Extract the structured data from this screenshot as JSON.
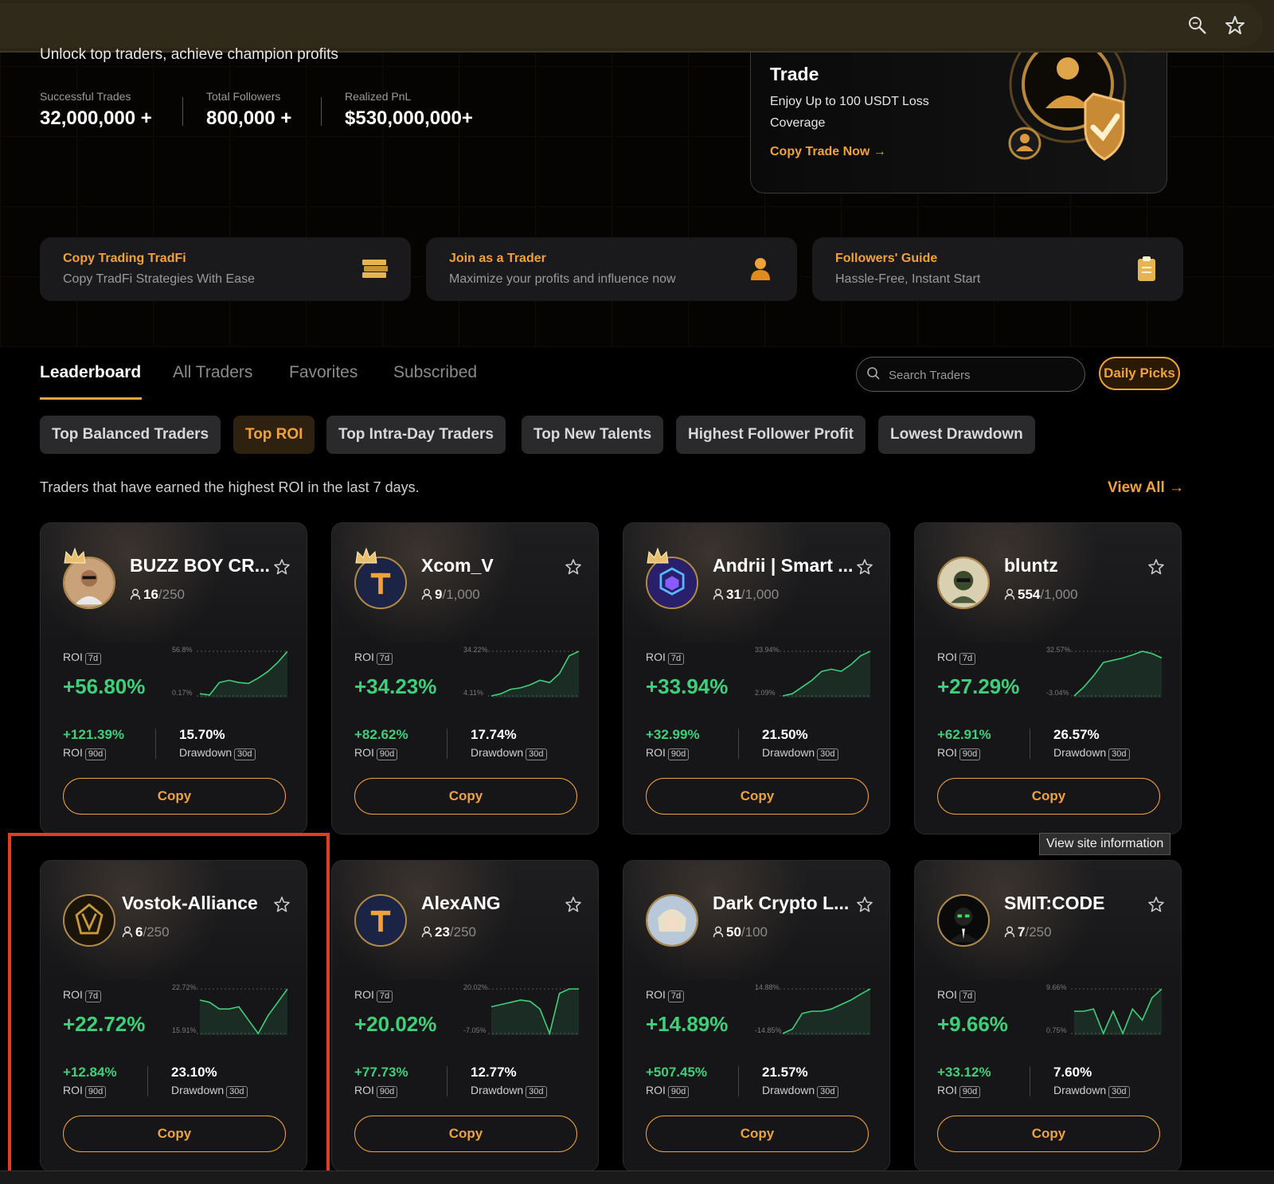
{
  "hero": {
    "subtitle": "Unlock top traders, achieve champion profits",
    "stats": [
      {
        "label": "Successful Trades",
        "value": "32,000,000 +"
      },
      {
        "label": "Total Followers",
        "value": "800,000 +"
      },
      {
        "label": "Realized PnL",
        "value": "$530,000,000+"
      }
    ],
    "promo": {
      "title": "Trade",
      "text": "Enjoy Up to 100 USDT Loss Coverage",
      "cta": "Copy Trade Now →"
    }
  },
  "quick_links": [
    {
      "title": "Copy Trading TradFi",
      "subtitle": "Copy TradFi Strategies With Ease",
      "icon": "gold-bars-icon"
    },
    {
      "title": "Join as a Trader",
      "subtitle": "Maximize your profits and influence now",
      "icon": "trader-person-icon"
    },
    {
      "title": "Followers' Guide",
      "subtitle": "Hassle-Free, Instant Start",
      "icon": "clipboard-icon"
    }
  ],
  "tabs": [
    "Leaderboard",
    "All Traders",
    "Favorites",
    "Subscribed"
  ],
  "search": {
    "placeholder": "Search Traders"
  },
  "daily_picks": "Daily Picks",
  "filters": [
    "Top Balanced Traders",
    "Top ROI",
    "Top Intra-Day Traders",
    "Top New Talents",
    "Highest Follower Profit",
    "Lowest Drawdown"
  ],
  "description": "Traders that have earned the highest ROI in the last 7 days.",
  "view_all": "View All →",
  "labels": {
    "roi": "ROI",
    "drawdown": "Drawdown",
    "d7": "7d",
    "d90": "90d",
    "d30": "30d",
    "copy": "Copy"
  },
  "tooltip": "View site information",
  "traders": [
    {
      "name": "BUZZ BOY CR...",
      "followers": "16",
      "cap": "/250",
      "roi7": "+56.80%",
      "spark_max": "56.8%",
      "spark_min": "0.17%",
      "roi90": "+121.39%",
      "drawdown": "15.70%",
      "crown": true,
      "spark": [
        0.05,
        0.02,
        0.3,
        0.35,
        0.3,
        0.28,
        0.4,
        0.55,
        0.75,
        1.0
      ]
    },
    {
      "name": "Xcom_V",
      "followers": "9",
      "cap": "/1,000",
      "roi7": "+34.23%",
      "spark_max": "34.22%",
      "spark_min": "4.11%",
      "roi90": "+82.62%",
      "drawdown": "17.74%",
      "crown": true,
      "spark": [
        0.0,
        0.05,
        0.15,
        0.18,
        0.25,
        0.35,
        0.3,
        0.5,
        0.9,
        1.0
      ]
    },
    {
      "name": "Andrii | Smart ...",
      "followers": "31",
      "cap": "/1,000",
      "roi7": "+33.94%",
      "spark_max": "33.94%",
      "spark_min": "2.09%",
      "roi90": "+32.99%",
      "drawdown": "21.50%",
      "crown": true,
      "spark": [
        0.0,
        0.05,
        0.2,
        0.35,
        0.55,
        0.6,
        0.55,
        0.7,
        0.9,
        1.0
      ]
    },
    {
      "name": "bluntz",
      "followers": "554",
      "cap": "/1,000",
      "roi7": "+27.29%",
      "spark_max": "32.57%",
      "spark_min": "-3.04%",
      "roi90": "+62.91%",
      "drawdown": "26.57%",
      "crown": false,
      "spark": [
        0.0,
        0.2,
        0.45,
        0.75,
        0.8,
        0.85,
        0.92,
        1.0,
        0.95,
        0.85
      ]
    },
    {
      "name": "Vostok-Alliance",
      "followers": "6",
      "cap": "/250",
      "roi7": "+22.72%",
      "spark_max": "22.72%",
      "spark_min": "15.91%",
      "roi90": "+12.84%",
      "drawdown": "23.10%",
      "crown": false,
      "spark": [
        0.75,
        0.7,
        0.55,
        0.55,
        0.6,
        0.3,
        0.0,
        0.4,
        0.7,
        1.0
      ]
    },
    {
      "name": "AlexANG",
      "followers": "23",
      "cap": "/250",
      "roi7": "+20.02%",
      "spark_max": "20.02%",
      "spark_min": "-7.05%",
      "roi90": "+77.73%",
      "drawdown": "12.77%",
      "crown": false,
      "spark": [
        0.6,
        0.65,
        0.7,
        0.75,
        0.72,
        0.55,
        0.0,
        0.9,
        1.0,
        1.0
      ]
    },
    {
      "name": "Dark Crypto L...",
      "followers": "50",
      "cap": "/100",
      "roi7": "+14.89%",
      "spark_max": "14.88%",
      "spark_min": "-14.85%",
      "roi90": "+507.45%",
      "drawdown": "21.57%",
      "crown": false,
      "spark": [
        0.0,
        0.1,
        0.45,
        0.5,
        0.5,
        0.55,
        0.65,
        0.75,
        0.88,
        1.0
      ]
    },
    {
      "name": "SMIT:CODE",
      "followers": "7",
      "cap": "/250",
      "roi7": "+9.66%",
      "spark_max": "9.66%",
      "spark_min": "0.75%",
      "roi90": "+33.12%",
      "drawdown": "7.60%",
      "crown": false,
      "spark": [
        0.5,
        0.5,
        0.55,
        0.0,
        0.5,
        0.0,
        0.55,
        0.3,
        0.8,
        1.0
      ]
    }
  ]
}
